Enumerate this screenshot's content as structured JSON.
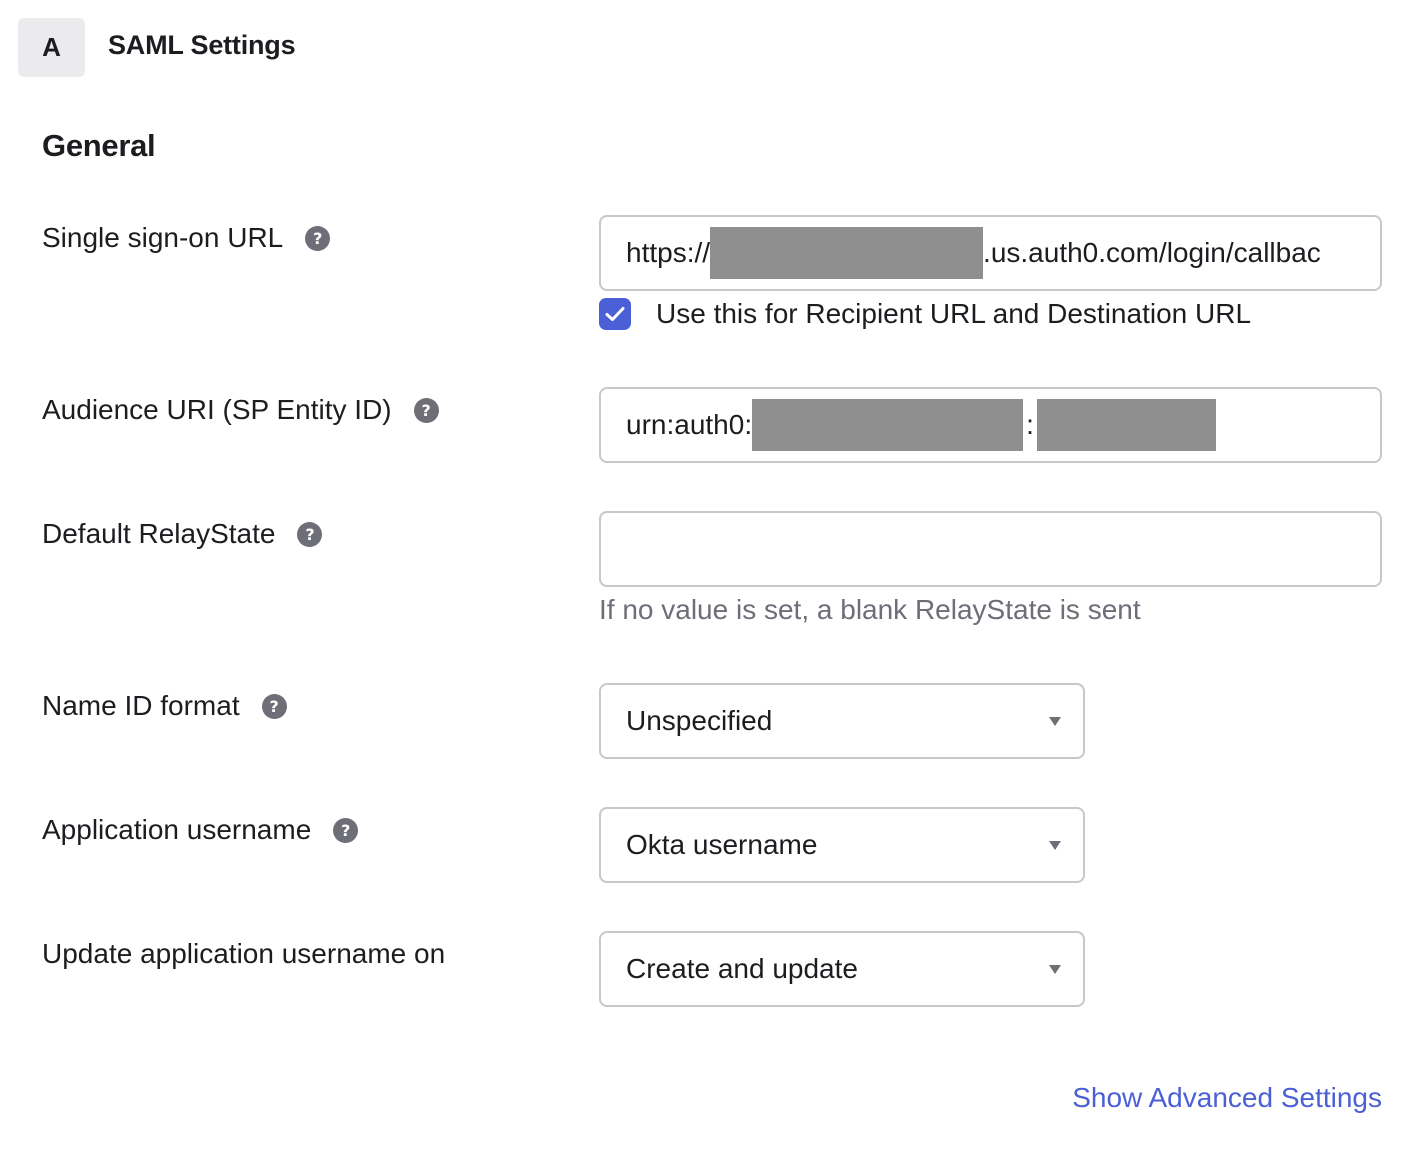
{
  "step": {
    "badge": "A",
    "title": "SAML Settings"
  },
  "section": {
    "title": "General"
  },
  "fields": {
    "sso_url": {
      "label": "Single sign-on URL",
      "help": "?",
      "prefix": "https://",
      "suffix": ".us.auth0.com/login/callbac",
      "checkbox_checked": true,
      "checkbox_label": "Use this for Recipient URL and Destination URL"
    },
    "audience_uri": {
      "label": "Audience URI (SP Entity ID)",
      "help": "?",
      "prefix": "urn:auth0:",
      "separator": ":"
    },
    "relay_state": {
      "label": "Default RelayState",
      "help": "?",
      "value": "",
      "hint": "If no value is set, a blank RelayState is sent"
    },
    "name_id_format": {
      "label": "Name ID format",
      "help": "?",
      "selected": "Unspecified"
    },
    "app_username": {
      "label": "Application username",
      "help": "?",
      "selected": "Okta username"
    },
    "update_username_on": {
      "label": "Update application username on",
      "selected": "Create and update"
    }
  },
  "actions": {
    "show_advanced": "Show Advanced Settings"
  },
  "colors": {
    "accent": "#4b5fd6",
    "help_icon": "#6e6e78",
    "redaction": "#8f8f8f"
  }
}
